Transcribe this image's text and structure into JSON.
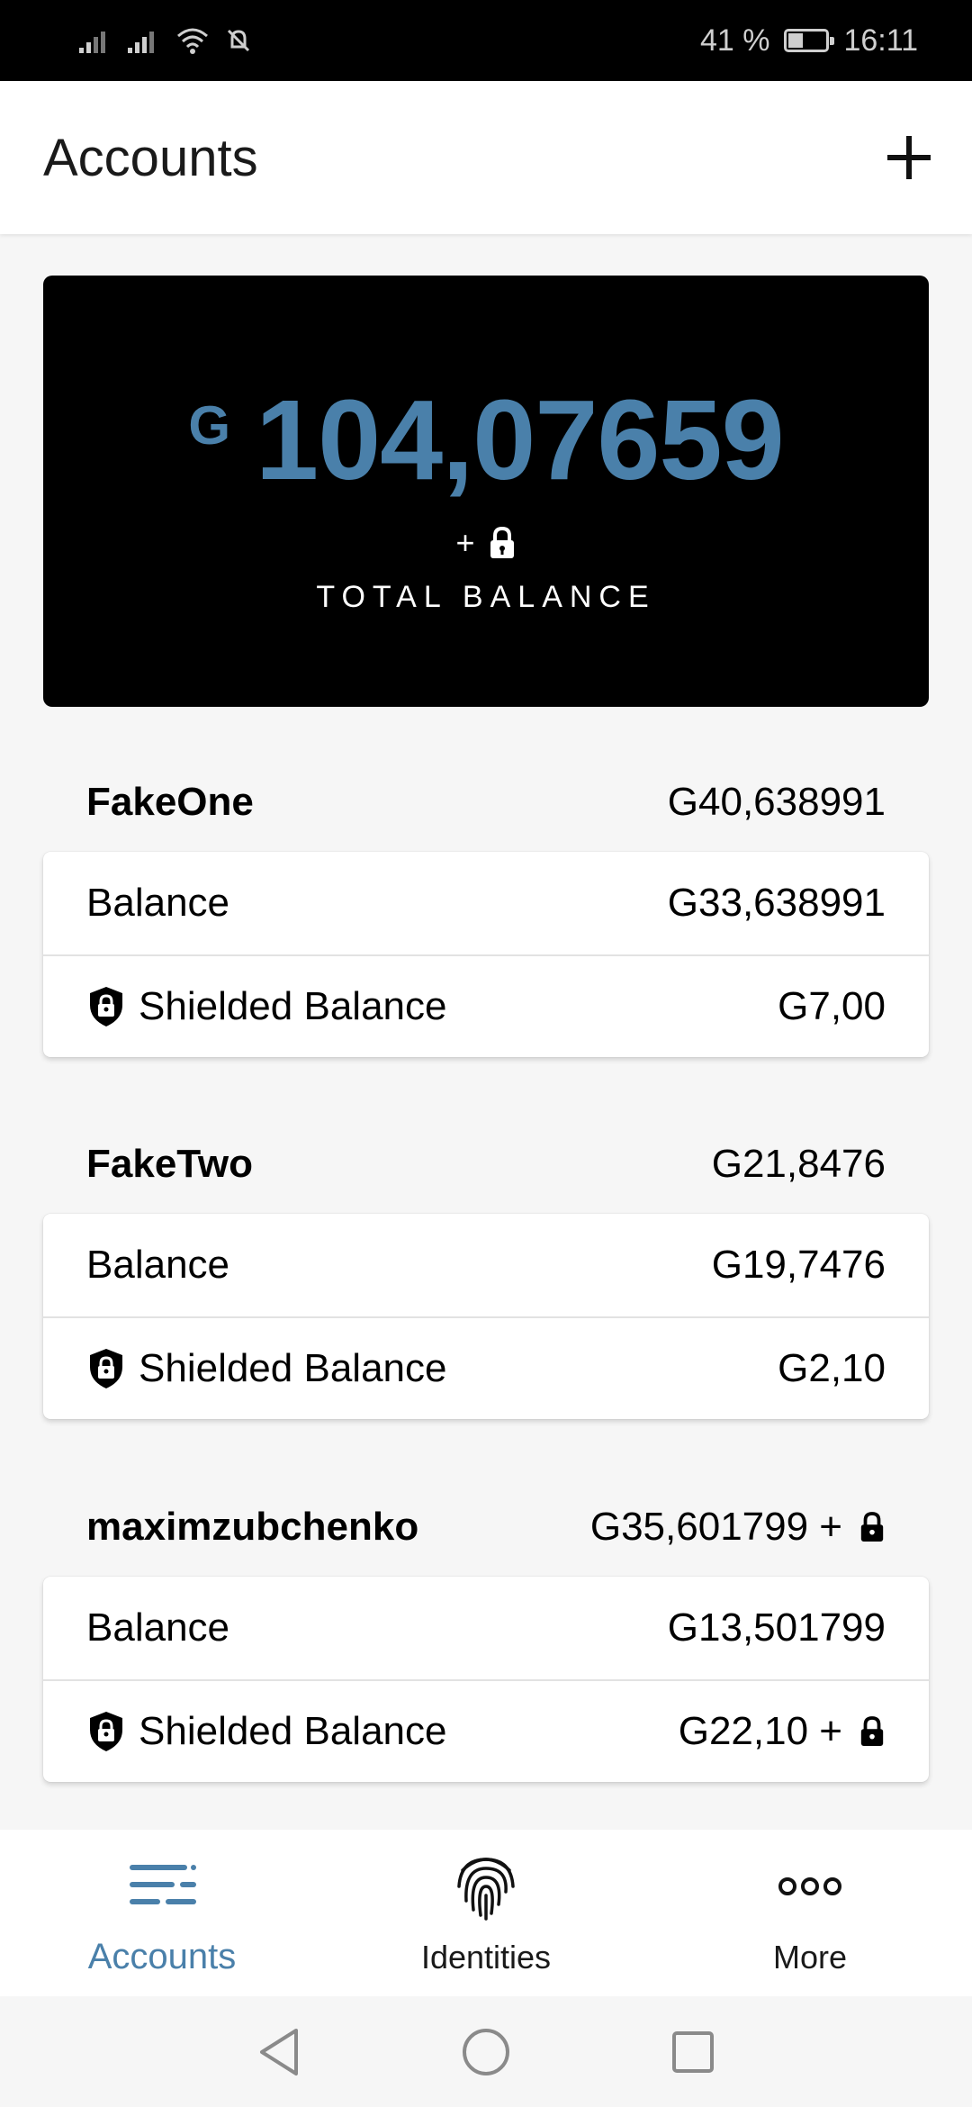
{
  "status_bar": {
    "battery_percent": "41 %",
    "time": "16:11",
    "icons": [
      "signal-icon",
      "signal-icon",
      "wifi-icon",
      "muted-bell-icon",
      "battery-icon"
    ]
  },
  "header": {
    "title": "Accounts",
    "add_icon": "plus-icon"
  },
  "total_balance": {
    "currency": "G",
    "amount": "104,07659",
    "plus": "+",
    "label": "TOTAL BALANCE"
  },
  "accounts": [
    {
      "name": "FakeOne",
      "total": "G40,638991",
      "balance_label": "Balance",
      "balance_value": "G33,638991",
      "shielded_label": "Shielded Balance",
      "shielded_value": "G7,00"
    },
    {
      "name": "FakeTwo",
      "total": "G21,8476",
      "balance_label": "Balance",
      "balance_value": "G19,7476",
      "shielded_label": "Shielded Balance",
      "shielded_value": "G2,10"
    },
    {
      "name": "maximzubchenko",
      "total": "G35,601799 +",
      "balance_label": "Balance",
      "balance_value": "G13,501799",
      "shielded_label": "Shielded Balance",
      "shielded_value": "G22,10 +"
    }
  ],
  "bottom_nav": {
    "items": [
      {
        "label": "Accounts",
        "icon": "list-icon"
      },
      {
        "label": "Identities",
        "icon": "fingerprint-icon"
      },
      {
        "label": "More",
        "icon": "more-icon"
      }
    ]
  },
  "colors": {
    "accent": "#4a80aa",
    "card_bg": "#000000",
    "page_bg": "#f6f6f6"
  }
}
